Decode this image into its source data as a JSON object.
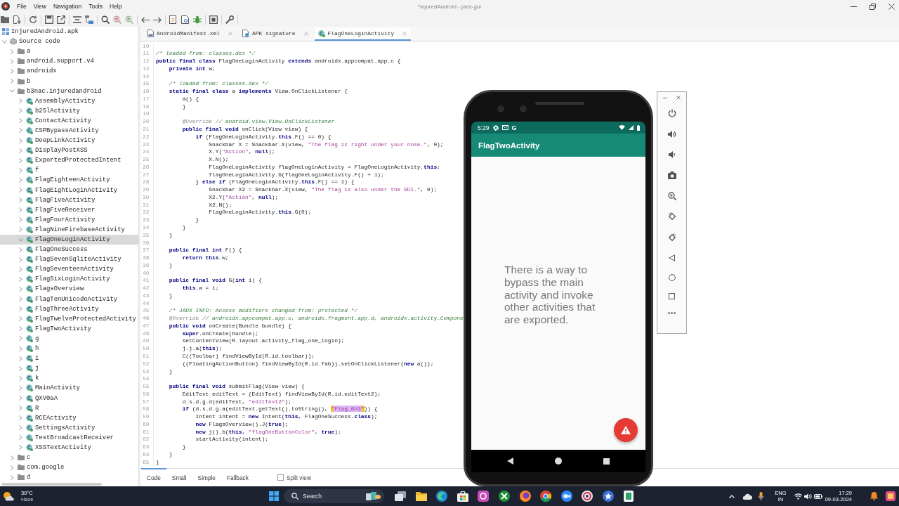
{
  "window": {
    "title": "*InjuredAndroid - jadx-gui"
  },
  "menu": [
    "File",
    "View",
    "Navigation",
    "Tools",
    "Help"
  ],
  "tree": [
    {
      "label": "InjuredAndroid.apk",
      "kind": "apk",
      "selected": false,
      "children": [
        {
          "label": "Source code",
          "kind": "source",
          "expanded": true,
          "selected": false,
          "children": [
            {
              "label": "a",
              "kind": "package",
              "expanded": false,
              "selected": false
            },
            {
              "label": "android.support.v4",
              "kind": "package",
              "expanded": false,
              "selected": false
            },
            {
              "label": "androidx",
              "kind": "package",
              "expanded": false,
              "selected": false
            },
            {
              "label": "b",
              "kind": "package",
              "expanded": false,
              "selected": false
            },
            {
              "label": "b3nac.injuredandroid",
              "kind": "package",
              "expanded": true,
              "selected": false,
              "children": [
                {
                  "label": "AssemblyActivity",
                  "kind": "class",
                  "expanded": false,
                  "selected": false
                },
                {
                  "label": "b25lActivity",
                  "kind": "class",
                  "expanded": false,
                  "selected": false
                },
                {
                  "label": "ContactActivity",
                  "kind": "class",
                  "expanded": false,
                  "selected": false
                },
                {
                  "label": "CSPBypassActivity",
                  "kind": "class",
                  "expanded": false,
                  "selected": false
                },
                {
                  "label": "DeepLinkActivity",
                  "kind": "class",
                  "expanded": false,
                  "selected": false
                },
                {
                  "label": "DisplayPostXSS",
                  "kind": "class",
                  "expanded": false,
                  "selected": false
                },
                {
                  "label": "ExportedProtectedIntent",
                  "kind": "class",
                  "expanded": false,
                  "selected": false
                },
                {
                  "label": "f",
                  "kind": "class",
                  "expanded": false,
                  "selected": false
                },
                {
                  "label": "FlagEighteenActivity",
                  "kind": "class",
                  "expanded": false,
                  "selected": false
                },
                {
                  "label": "FlagEightLoginActivity",
                  "kind": "class",
                  "expanded": false,
                  "selected": false
                },
                {
                  "label": "FlagFiveActivity",
                  "kind": "class",
                  "expanded": false,
                  "selected": false
                },
                {
                  "label": "FlagFiveReceiver",
                  "kind": "class",
                  "expanded": false,
                  "selected": false
                },
                {
                  "label": "FlagFourActivity",
                  "kind": "class",
                  "expanded": false,
                  "selected": false
                },
                {
                  "label": "FlagNineFirebaseActivity",
                  "kind": "class",
                  "expanded": false,
                  "selected": false
                },
                {
                  "label": "FlagOneLoginActivity",
                  "kind": "class",
                  "expanded": true,
                  "selected": true
                },
                {
                  "label": "FlagOneSuccess",
                  "kind": "class",
                  "expanded": false,
                  "selected": false
                },
                {
                  "label": "FlagSevenSqliteActivity",
                  "kind": "class",
                  "expanded": false,
                  "selected": false
                },
                {
                  "label": "FlagSeventeenActivity",
                  "kind": "class",
                  "expanded": false,
                  "selected": false
                },
                {
                  "label": "FlagSixLoginActivity",
                  "kind": "class",
                  "expanded": false,
                  "selected": false
                },
                {
                  "label": "FlagsOverview",
                  "kind": "class",
                  "expanded": false,
                  "selected": false
                },
                {
                  "label": "FlagTenUnicodeActivity",
                  "kind": "class",
                  "expanded": false,
                  "selected": false
                },
                {
                  "label": "FlagThreeActivity",
                  "kind": "class",
                  "expanded": false,
                  "selected": false
                },
                {
                  "label": "FlagTwelveProtectedActivity",
                  "kind": "class",
                  "expanded": false,
                  "selected": false
                },
                {
                  "label": "FlagTwoActivity",
                  "kind": "class",
                  "expanded": false,
                  "selected": false
                },
                {
                  "label": "g",
                  "kind": "class",
                  "expanded": false,
                  "selected": false
                },
                {
                  "label": "h",
                  "kind": "class",
                  "expanded": false,
                  "selected": false
                },
                {
                  "label": "i",
                  "kind": "class",
                  "expanded": false,
                  "selected": false
                },
                {
                  "label": "j",
                  "kind": "class",
                  "expanded": false,
                  "selected": false
                },
                {
                  "label": "k",
                  "kind": "class",
                  "expanded": false,
                  "selected": false
                },
                {
                  "label": "MainActivity",
                  "kind": "class",
                  "expanded": false,
                  "selected": false
                },
                {
                  "label": "QXV0aA",
                  "kind": "class",
                  "expanded": false,
                  "selected": false
                },
                {
                  "label": "R",
                  "kind": "class",
                  "expanded": false,
                  "selected": false
                },
                {
                  "label": "RCEActivity",
                  "kind": "class",
                  "expanded": false,
                  "selected": false
                },
                {
                  "label": "SettingsActivity",
                  "kind": "class",
                  "expanded": false,
                  "selected": false
                },
                {
                  "label": "TestBroadcastReceiver",
                  "kind": "class",
                  "expanded": false,
                  "selected": false
                },
                {
                  "label": "XSSTextActivity",
                  "kind": "class",
                  "expanded": false,
                  "selected": false
                }
              ]
            },
            {
              "label": "c",
              "kind": "package",
              "expanded": false,
              "selected": false
            },
            {
              "label": "com.google",
              "kind": "package",
              "expanded": false,
              "selected": false
            },
            {
              "label": "d",
              "kind": "package",
              "expanded": false,
              "selected": false
            }
          ]
        }
      ]
    }
  ],
  "editor_tabs": [
    {
      "label": "AndroidManifest.xml",
      "kind": "xml",
      "selected": false
    },
    {
      "label": "APK signature",
      "kind": "signature",
      "selected": false
    },
    {
      "label": "FlagOneLoginActivity",
      "kind": "class",
      "selected": true
    }
  ],
  "code": {
    "lines": [
      {
        "number": "10"
      },
      {
        "number": "11",
        "segments": [
          {
            "kind": "comment",
            "text": "/* loaded from: classes.dex */"
          }
        ]
      },
      {
        "number": "12",
        "segments": [
          {
            "kind": "keyword",
            "text": "public final class"
          },
          {
            "kind": "plain",
            "text": " FlagOneLoginActivity "
          },
          {
            "kind": "keyword",
            "text": "extends"
          },
          {
            "kind": "plain",
            "text": " androidx.appcompat.app.c {"
          }
        ]
      },
      {
        "number": "13",
        "segments": [
          {
            "kind": "keyword",
            "text": "    private int"
          },
          {
            "kind": "plain",
            "text": " w;"
          }
        ]
      },
      {
        "number": "14"
      },
      {
        "number": "15",
        "segments": [
          {
            "kind": "comment",
            "text": "    /* loaded from: classes.dex */"
          }
        ]
      },
      {
        "number": "16",
        "segments": [
          {
            "kind": "keyword",
            "text": "    static final class"
          },
          {
            "kind": "plain",
            "text": " a "
          },
          {
            "kind": "keyword",
            "text": "implements"
          },
          {
            "kind": "plain",
            "text": " View.OnClickListener {"
          }
        ]
      },
      {
        "number": "17",
        "segments": [
          {
            "kind": "plain",
            "text": "        a() {"
          }
        ]
      },
      {
        "number": "18",
        "segments": [
          {
            "kind": "plain",
            "text": "        }"
          }
        ]
      },
      {
        "number": "19"
      },
      {
        "number": "20",
        "segments": [
          {
            "kind": "annotation",
            "text": "        @Override"
          },
          {
            "kind": "comment",
            "text": " // android.view.View.OnClickListener"
          }
        ]
      },
      {
        "number": "21",
        "segments": [
          {
            "kind": "keyword",
            "text": "        public final void"
          },
          {
            "kind": "plain",
            "text": " onClick(View view) {"
          }
        ]
      },
      {
        "number": "22",
        "segments": [
          {
            "kind": "keyword",
            "text": "            if"
          },
          {
            "kind": "plain",
            "text": " (FlagOneLoginActivity."
          },
          {
            "kind": "keyword",
            "text": "this"
          },
          {
            "kind": "plain",
            "text": ".F() == 0) {"
          }
        ]
      },
      {
        "number": "23",
        "segments": [
          {
            "kind": "plain",
            "text": "                Snackbar X = Snackbar.X(view, "
          },
          {
            "kind": "string",
            "text": "\"The flag is right under your nose.\""
          },
          {
            "kind": "plain",
            "text": ", 0);"
          }
        ]
      },
      {
        "number": "24",
        "segments": [
          {
            "kind": "plain",
            "text": "                X.Y("
          },
          {
            "kind": "string",
            "text": "\"Action\""
          },
          {
            "kind": "plain",
            "text": ", "
          },
          {
            "kind": "keyword",
            "text": "null"
          },
          {
            "kind": "plain",
            "text": ");"
          }
        ]
      },
      {
        "number": "25",
        "segments": [
          {
            "kind": "plain",
            "text": "                X.N();"
          }
        ]
      },
      {
        "number": "26",
        "segments": [
          {
            "kind": "plain",
            "text": "                FlagOneLoginActivity flagOneLoginActivity = FlagOneLoginActivity."
          },
          {
            "kind": "keyword",
            "text": "this"
          },
          {
            "kind": "plain",
            "text": ";"
          }
        ]
      },
      {
        "number": "27",
        "segments": [
          {
            "kind": "plain",
            "text": "                flagOneLoginActivity.G(flagOneLoginActivity.F() + 1);"
          }
        ]
      },
      {
        "number": "28",
        "segments": [
          {
            "kind": "plain",
            "text": "            } "
          },
          {
            "kind": "keyword",
            "text": "else if"
          },
          {
            "kind": "plain",
            "text": " (FlagOneLoginActivity."
          },
          {
            "kind": "keyword",
            "text": "this"
          },
          {
            "kind": "plain",
            "text": ".F() == 1) {"
          }
        ]
      },
      {
        "number": "29",
        "segments": [
          {
            "kind": "plain",
            "text": "                Snackbar X2 = Snackbar.X(view, "
          },
          {
            "kind": "string",
            "text": "\"The flag is also under the GUI.\""
          },
          {
            "kind": "plain",
            "text": ", 0);"
          }
        ]
      },
      {
        "number": "30",
        "segments": [
          {
            "kind": "plain",
            "text": "                X2.Y("
          },
          {
            "kind": "string",
            "text": "\"Action\""
          },
          {
            "kind": "plain",
            "text": ", "
          },
          {
            "kind": "keyword",
            "text": "null"
          },
          {
            "kind": "plain",
            "text": ");"
          }
        ]
      },
      {
        "number": "31",
        "segments": [
          {
            "kind": "plain",
            "text": "                X2.N();"
          }
        ]
      },
      {
        "number": "32",
        "segments": [
          {
            "kind": "plain",
            "text": "                FlagOneLoginActivity."
          },
          {
            "kind": "keyword",
            "text": "this"
          },
          {
            "kind": "plain",
            "text": ".G(0);"
          }
        ]
      },
      {
        "number": "33",
        "segments": [
          {
            "kind": "plain",
            "text": "            }"
          }
        ]
      },
      {
        "number": "34",
        "segments": [
          {
            "kind": "plain",
            "text": "        }"
          }
        ]
      },
      {
        "number": "35",
        "segments": [
          {
            "kind": "plain",
            "text": "    }"
          }
        ]
      },
      {
        "number": "36"
      },
      {
        "number": "37",
        "segments": [
          {
            "kind": "keyword",
            "text": "    public final int"
          },
          {
            "kind": "plain",
            "text": " F() {"
          }
        ]
      },
      {
        "number": "38",
        "segments": [
          {
            "kind": "keyword",
            "text": "        return this"
          },
          {
            "kind": "plain",
            "text": ".w;"
          }
        ]
      },
      {
        "number": "39",
        "segments": [
          {
            "kind": "plain",
            "text": "    }"
          }
        ]
      },
      {
        "number": "40"
      },
      {
        "number": "41",
        "segments": [
          {
            "kind": "keyword",
            "text": "    public final void"
          },
          {
            "kind": "plain",
            "text": " G("
          },
          {
            "kind": "keyword",
            "text": "int"
          },
          {
            "kind": "plain",
            "text": " i) {"
          }
        ]
      },
      {
        "number": "42",
        "segments": [
          {
            "kind": "keyword",
            "text": "        this"
          },
          {
            "kind": "plain",
            "text": ".w = i;"
          }
        ]
      },
      {
        "number": "43",
        "segments": [
          {
            "kind": "plain",
            "text": "    }"
          }
        ]
      },
      {
        "number": "44"
      },
      {
        "number": "45",
        "segments": [
          {
            "kind": "comment",
            "text": "    /* JADX INFO: Access modifiers changed from: protected */"
          }
        ]
      },
      {
        "number": "46",
        "segments": [
          {
            "kind": "annotation",
            "text": "    @Override"
          },
          {
            "kind": "comment",
            "text": " // androidx.appcompat.app.c, androidx.fragment.app.d, androidx.activity.Compone"
          }
        ]
      },
      {
        "number": "47",
        "segments": [
          {
            "kind": "keyword",
            "text": "    public void"
          },
          {
            "kind": "plain",
            "text": " onCreate(Bundle bundle) {"
          }
        ]
      },
      {
        "number": "48",
        "segments": [
          {
            "kind": "keyword",
            "text": "        super"
          },
          {
            "kind": "plain",
            "text": ".onCreate(bundle);"
          }
        ]
      },
      {
        "number": "49",
        "segments": [
          {
            "kind": "plain",
            "text": "        setContentView(R.layout.activity_flag_one_login);"
          }
        ]
      },
      {
        "number": "50",
        "segments": [
          {
            "kind": "plain",
            "text": "        j.j.a("
          },
          {
            "kind": "keyword",
            "text": "this"
          },
          {
            "kind": "plain",
            "text": ");"
          }
        ]
      },
      {
        "number": "51",
        "segments": [
          {
            "kind": "plain",
            "text": "        C((Toolbar) findViewById(R.id.toolbar));"
          }
        ]
      },
      {
        "number": "52",
        "segments": [
          {
            "kind": "plain",
            "text": "        ((FloatingActionButton) findViewById(R.id.fab)).setOnClickListener("
          },
          {
            "kind": "keyword",
            "text": "new"
          },
          {
            "kind": "plain",
            "text": " a());"
          }
        ]
      },
      {
        "number": "53",
        "segments": [
          {
            "kind": "plain",
            "text": "    }"
          }
        ]
      },
      {
        "number": "54"
      },
      {
        "number": "55",
        "segments": [
          {
            "kind": "keyword",
            "text": "    public final void"
          },
          {
            "kind": "plain",
            "text": " submitFlag(View view) {"
          }
        ]
      },
      {
        "number": "56",
        "segments": [
          {
            "kind": "plain",
            "text": "        EditText editText = (EditText) findViewById(R.id.editText2);"
          }
        ]
      },
      {
        "number": "57",
        "segments": [
          {
            "kind": "plain",
            "text": "        d.s.d.g.d(editText, "
          },
          {
            "kind": "string",
            "text": "\"editText2\""
          },
          {
            "kind": "plain",
            "text": ");"
          }
        ]
      },
      {
        "number": "58",
        "segments": [
          {
            "kind": "keyword",
            "text": "        if"
          },
          {
            "kind": "plain",
            "text": " (d.s.d.g.a(editText.getText().toString(), "
          },
          {
            "kind": "match",
            "text": "\"Flag_0n3\""
          },
          {
            "kind": "plain",
            "text": ")) {"
          }
        ]
      },
      {
        "number": "59",
        "segments": [
          {
            "kind": "plain",
            "text": "            Intent intent = "
          },
          {
            "kind": "keyword",
            "text": "new"
          },
          {
            "kind": "plain",
            "text": " Intent("
          },
          {
            "kind": "keyword",
            "text": "this"
          },
          {
            "kind": "plain",
            "text": ", FlagOneSuccess."
          },
          {
            "kind": "keyword",
            "text": "class"
          },
          {
            "kind": "plain",
            "text": ");"
          }
        ]
      },
      {
        "number": "60",
        "segments": [
          {
            "kind": "keyword",
            "text": "            new"
          },
          {
            "kind": "plain",
            "text": " FlagsOverview().J("
          },
          {
            "kind": "keyword",
            "text": "true"
          },
          {
            "kind": "plain",
            "text": ");"
          }
        ]
      },
      {
        "number": "61",
        "segments": [
          {
            "kind": "keyword",
            "text": "            new"
          },
          {
            "kind": "plain",
            "text": " j().b("
          },
          {
            "kind": "keyword",
            "text": "this"
          },
          {
            "kind": "plain",
            "text": ", "
          },
          {
            "kind": "string",
            "text": "\"flagOneButtonColor\""
          },
          {
            "kind": "plain",
            "text": ", "
          },
          {
            "kind": "keyword",
            "text": "true"
          },
          {
            "kind": "plain",
            "text": ");"
          }
        ]
      },
      {
        "number": "62",
        "segments": [
          {
            "kind": "plain",
            "text": "            startActivity(intent);"
          }
        ]
      },
      {
        "number": "63",
        "segments": [
          {
            "kind": "plain",
            "text": "        }"
          }
        ]
      },
      {
        "number": "64",
        "segments": [
          {
            "kind": "plain",
            "text": "    }"
          }
        ]
      },
      {
        "number": "65",
        "segments": [
          {
            "kind": "plain",
            "text": "}"
          }
        ]
      }
    ]
  },
  "view_tabs": [
    {
      "label": "Code",
      "selected": true
    },
    {
      "label": "Smali",
      "selected": false
    },
    {
      "label": "Simple",
      "selected": false
    },
    {
      "label": "Fallback",
      "selected": false
    }
  ],
  "split_view": {
    "label": "Split view",
    "checked": false
  },
  "emulator": {
    "status_bar": {
      "time": "5:29",
      "notification_letter": "G"
    },
    "app_bar": {
      "title": "FlagTwoActivity"
    },
    "message": "There is a way to bypass the main activity and invoke other activities that are exported."
  },
  "taskbar": {
    "weather": {
      "temperature": "30°C",
      "condition": "Haze"
    },
    "search": {
      "placeholder": "Search"
    },
    "input_language": {
      "language": "ENG",
      "region": "IN"
    },
    "clock": {
      "time": "17:29",
      "date": "09-03-2024"
    }
  }
}
